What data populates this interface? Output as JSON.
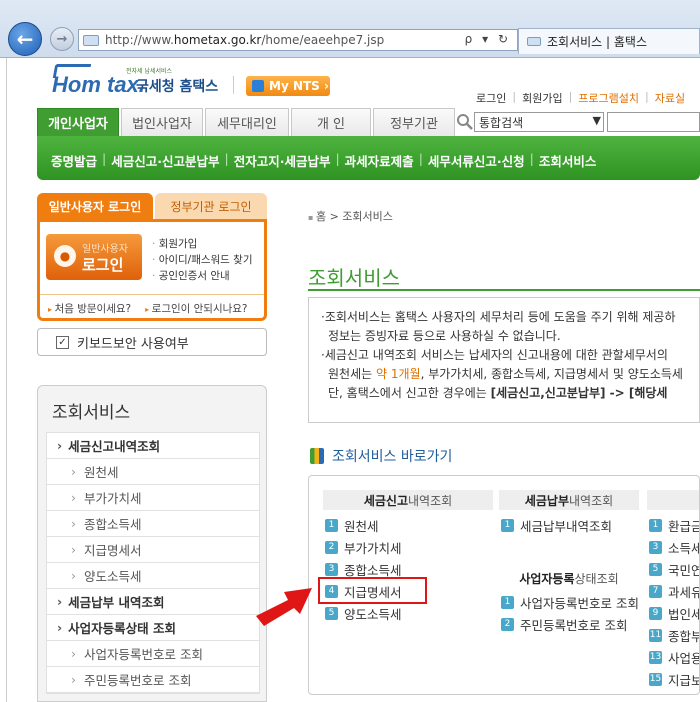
{
  "browser": {
    "url_prefix": "http://www.",
    "url_domain": "hometax.go.kr",
    "url_path": "/home/eaeehpe7.jsp",
    "addr_tools": "ρ ▾ ↻",
    "tab_title": "조회서비스 | 홈택스"
  },
  "header": {
    "logo_text": "Hom tax.",
    "logo_sub": "전자세 납세서비스",
    "site_name": "국세청 홈택스",
    "mynts_label": "My NTS ›",
    "util": [
      "로그인",
      "회원가입",
      "프로그램설치",
      "자료실"
    ]
  },
  "main_tabs": [
    "개인사업자",
    "법인사업자",
    "세무대리인",
    "개 인",
    "정부기관"
  ],
  "search": {
    "selected": "통합검색"
  },
  "submenu": [
    "증명발급",
    "세금신고·신고분납부",
    "전자고지·세금납부",
    "과세자료제출",
    "세무서류신고·신청",
    "조회서비스"
  ],
  "login": {
    "tab_user": "일반사용자 로그인",
    "tab_gov": "정부기관 로그인",
    "btn_sub": "일반사용자",
    "btn_main": "로그인",
    "links": [
      "회원가입",
      "아이디/패스워드 찾기",
      "공인인증서 안내"
    ],
    "foot": [
      "처음 방문이세요?",
      "로그인이 안되시나요?"
    ]
  },
  "keyboard_security": {
    "label": "키보드보안 사용여부",
    "checked": "✓"
  },
  "left_menu": {
    "title": "조회서비스",
    "items": [
      {
        "label": "세금신고내역조회",
        "level": "main"
      },
      {
        "label": "원천세",
        "level": "sub"
      },
      {
        "label": "부가가치세",
        "level": "sub"
      },
      {
        "label": "종합소득세",
        "level": "sub"
      },
      {
        "label": "지급명세서",
        "level": "sub"
      },
      {
        "label": "양도소득세",
        "level": "sub"
      },
      {
        "label": "세금납부 내역조회",
        "level": "main"
      },
      {
        "label": "사업자등록상태 조회",
        "level": "main"
      },
      {
        "label": "사업자등록번호로 조회",
        "level": "sub"
      },
      {
        "label": "주민등록번호로 조회",
        "level": "sub"
      }
    ]
  },
  "content": {
    "breadcrumb": "홈 > 조회서비스",
    "title": "조회서비스",
    "info": {
      "line1": "·조회서비스는 홈택스 사용자의 세무처리 등에 도움을 주기 위해 제공하",
      "line2": "정보는 증빙자료 등으로 사용하실 수 없습니다.",
      "line3": "·세금신고 내역조회 서비스는 납세자의 신고내용에 대한 관할세무서의",
      "line4_a": "원천세는 ",
      "line4_b": "약 1개월",
      "line4_c": ", 부가가치세, 종합소득세, 지급명세서 및 양도소득세",
      "line5_a": "단, 홈택스에서 신고한 경우에는 ",
      "line5_b": "[세금신고,신고분납부] -> [해당세"
    },
    "shortcut_title": "조회서비스 바로가기",
    "col1": {
      "head_bold": "세금신고",
      "head_light": " 내역조회",
      "items": [
        {
          "n": "1",
          "label": "원천세"
        },
        {
          "n": "2",
          "label": "부가가치세"
        },
        {
          "n": "3",
          "label": "종합소득세"
        },
        {
          "n": "4",
          "label": "지급명세서"
        },
        {
          "n": "5",
          "label": "양도소득세"
        }
      ]
    },
    "col2": {
      "head_bold": "세금납부",
      "head_light": " 내역조회",
      "items": [
        {
          "n": "1",
          "label": "세금납부내역조회"
        }
      ],
      "head2_bold": "사업자등록",
      "head2_light": " 상태조회",
      "items2": [
        {
          "n": "1",
          "label": "사업자등록번호로 조회"
        },
        {
          "n": "2",
          "label": "주민등록번호로 조회"
        }
      ]
    },
    "col3": {
      "items": [
        {
          "n": "1",
          "label": "환급금"
        },
        {
          "n": "3",
          "label": "소득세"
        },
        {
          "n": "5",
          "label": "국민연"
        },
        {
          "n": "7",
          "label": "과세유"
        },
        {
          "n": "9",
          "label": "법인세"
        },
        {
          "n": "11",
          "label": "종합부"
        },
        {
          "n": "13",
          "label": "사업용"
        },
        {
          "n": "15",
          "label": "지급보"
        }
      ]
    }
  },
  "colors": {
    "green": "#3f9d32",
    "orange": "#f07d10",
    "highlight": "#e01515"
  }
}
